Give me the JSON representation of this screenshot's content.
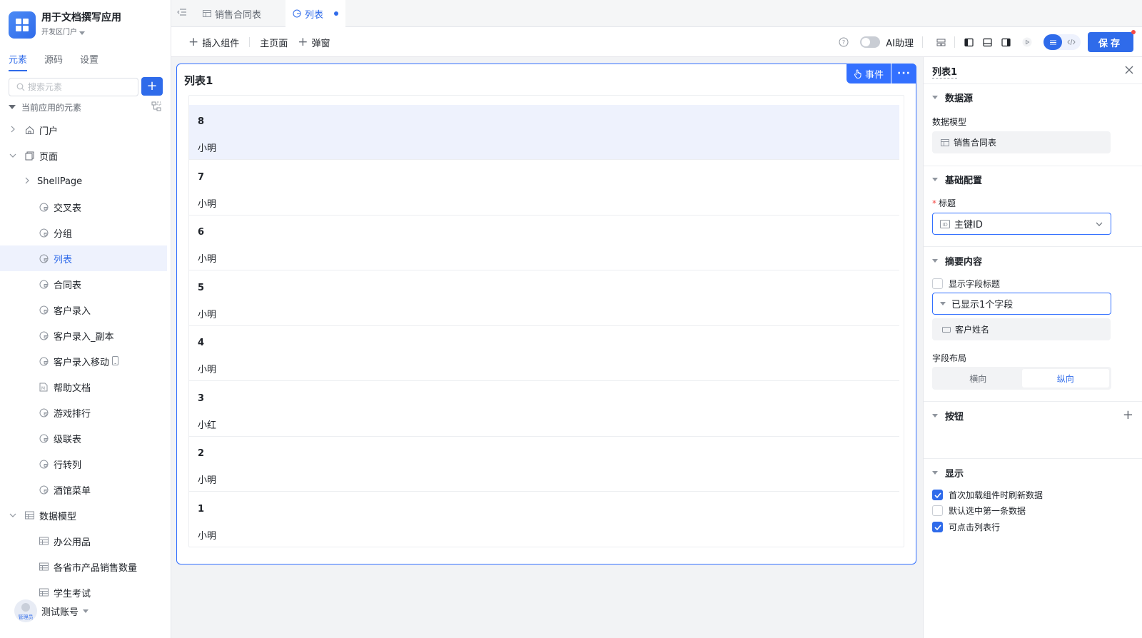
{
  "app": {
    "name": "用于文档撰写应用",
    "env": "开发区门户"
  },
  "sidebar": {
    "tabs": [
      {
        "label": "元素",
        "active": true
      },
      {
        "label": "源码",
        "active": false
      },
      {
        "label": "设置",
        "active": false
      }
    ],
    "search_placeholder": "搜索元素",
    "tree_header": "当前应用的元素",
    "tree": [
      {
        "label": "门户",
        "level": 0,
        "chevron": "›",
        "icon": "home-icon"
      },
      {
        "label": "页面",
        "level": 0,
        "chevron": "⌄",
        "icon": "pages-icon"
      },
      {
        "label": "ShellPage",
        "level": 1,
        "chevron": "›",
        "icon": ""
      },
      {
        "label": "交叉表",
        "level": 2,
        "chevron": "",
        "icon": "page-icon"
      },
      {
        "label": "分组",
        "level": 2,
        "chevron": "",
        "icon": "page-icon"
      },
      {
        "label": "列表",
        "level": 2,
        "chevron": "",
        "icon": "page-icon",
        "selected": true
      },
      {
        "label": "合同表",
        "level": 2,
        "chevron": "",
        "icon": "page-icon"
      },
      {
        "label": "客户录入",
        "level": 2,
        "chevron": "",
        "icon": "page-icon"
      },
      {
        "label": "客户录入_副本",
        "level": 2,
        "chevron": "",
        "icon": "page-icon"
      },
      {
        "label": "客户录入移动",
        "level": 2,
        "chevron": "",
        "icon": "page-icon",
        "mobile": true
      },
      {
        "label": "帮助文档",
        "level": 2,
        "chevron": "",
        "icon": "doc-icon"
      },
      {
        "label": "游戏排行",
        "level": 2,
        "chevron": "",
        "icon": "page-icon"
      },
      {
        "label": "级联表",
        "level": 2,
        "chevron": "",
        "icon": "page-icon"
      },
      {
        "label": "行转列",
        "level": 2,
        "chevron": "",
        "icon": "page-icon"
      },
      {
        "label": "酒馆菜单",
        "level": 2,
        "chevron": "",
        "icon": "page-icon"
      },
      {
        "label": "数据模型",
        "level": 0,
        "chevron": "⌄",
        "icon": "table-icon"
      },
      {
        "label": "办公用品",
        "level": 2,
        "chevron": "",
        "icon": "table-icon"
      },
      {
        "label": "各省市产品销售数量",
        "level": 2,
        "chevron": "",
        "icon": "table-icon"
      },
      {
        "label": "学生考试",
        "level": 2,
        "chevron": "",
        "icon": "table-icon"
      }
    ],
    "account": {
      "name": "测试账号",
      "role": "管理员"
    }
  },
  "tabs": [
    {
      "label": "销售合同表",
      "active": false,
      "icon": "table-icon"
    },
    {
      "label": "列表",
      "active": true,
      "icon": "page-icon",
      "unsaved": true
    }
  ],
  "toolbar": {
    "insert_label": "插入组件",
    "home_label": "主页面",
    "popup_label": "弹窗",
    "ai_label": "AI助理",
    "ai_enabled": false,
    "save_label": "保存"
  },
  "canvas": {
    "list_title": "列表1",
    "event_label": "事件",
    "more_label": "···",
    "rows": [
      {
        "id": "8",
        "name": "小明",
        "selected": true
      },
      {
        "id": "7",
        "name": "小明"
      },
      {
        "id": "6",
        "name": "小明"
      },
      {
        "id": "5",
        "name": "小明"
      },
      {
        "id": "4",
        "name": "小明"
      },
      {
        "id": "3",
        "name": "小红"
      },
      {
        "id": "2",
        "name": "小明"
      },
      {
        "id": "1",
        "name": "小明"
      }
    ]
  },
  "panel": {
    "title": "列表1",
    "sections": {
      "datasource": "数据源",
      "basic": "基础配置",
      "summary": "摘要内容",
      "buttons": "按钮",
      "display": "显示"
    },
    "datamodel_label": "数据模型",
    "datamodel_value": "销售合同表",
    "title_label": "标题",
    "title_value": "主键ID",
    "show_field_title": "显示字段标题",
    "show_field_title_checked": false,
    "fields_shown": "已显示1个字段",
    "field_item": "客户姓名",
    "layout_label": "字段布局",
    "layout_options": [
      "横向",
      "纵向"
    ],
    "layout_selected": "纵向",
    "display_options": [
      {
        "label": "首次加载组件时刷新数据",
        "checked": true
      },
      {
        "label": "默认选中第一条数据",
        "checked": false
      },
      {
        "label": "可点击列表行",
        "checked": true
      }
    ]
  },
  "colors": {
    "accent": "#2f6bea",
    "selected_bg": "#eef2fd",
    "border": "#e5e6eb"
  }
}
